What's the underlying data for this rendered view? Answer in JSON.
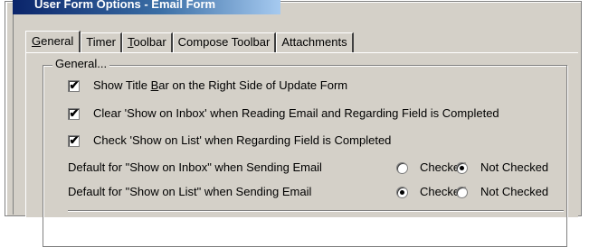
{
  "window": {
    "title": "User Form Options - Email Form"
  },
  "tabs": [
    {
      "label": "General",
      "mnemonic": "G",
      "rest": "eneral",
      "active": true
    },
    {
      "label": "Timer",
      "mnemonic": "",
      "rest": "Timer",
      "active": false
    },
    {
      "label": "Toolbar",
      "mnemonic": "T",
      "rest": "oolbar",
      "active": false
    },
    {
      "label": "Compose Toolbar",
      "mnemonic": "",
      "rest": "Compose Toolbar",
      "active": false
    },
    {
      "label": "Attachments",
      "mnemonic": "",
      "rest": "Attachments",
      "active": false
    }
  ],
  "group": {
    "legend": "General...",
    "checkboxes": [
      {
        "pre": "Show Title ",
        "mnemonic": "B",
        "post": "ar on the Right Side of Update Form",
        "checked": true
      },
      {
        "pre": "Clear 'Show on Inbox' when Reading Email and Regarding Field is Completed",
        "mnemonic": "",
        "post": "",
        "checked": true
      },
      {
        "pre": "Check 'Show on List' when Regarding Field is Completed",
        "mnemonic": "",
        "post": "",
        "checked": true
      }
    ],
    "radio_rows": [
      {
        "label": "Default for \"Show on Inbox\" when Sending Email",
        "options": [
          "Checked",
          "Not Checked"
        ],
        "selected": "Not Checked"
      },
      {
        "label": "Default for \"Show on List\" when Sending Email",
        "options": [
          "Checked",
          "Not Checked"
        ],
        "selected": "Checked"
      }
    ],
    "check_glyph": "✔"
  }
}
